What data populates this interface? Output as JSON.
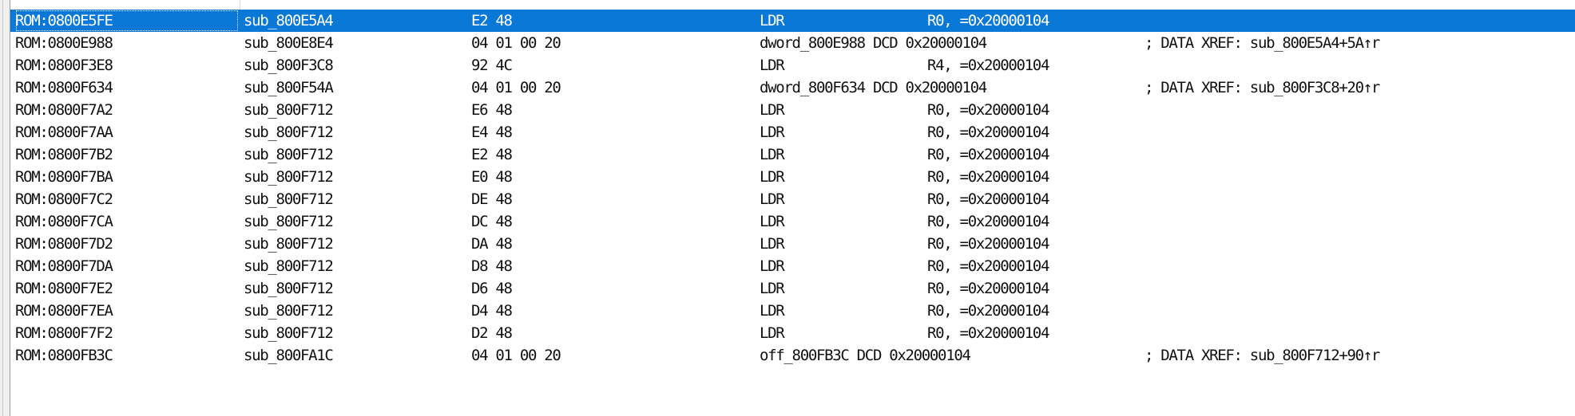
{
  "window": {
    "view": "IDA function xref listing"
  },
  "rows": [
    {
      "address": "ROM:0800E5FE",
      "function": "sub_800E5A4",
      "bytes": "E2 48",
      "mnemonic": "LDR",
      "operands": "R0, =0x20000104",
      "instruction": "",
      "comment": "",
      "selected": true
    },
    {
      "address": "ROM:0800E988",
      "function": "sub_800E8E4",
      "bytes": "04 01 00 20",
      "mnemonic": "",
      "operands": "",
      "instruction": "dword_800E988 DCD 0x20000104",
      "comment": "; DATA XREF: sub_800E5A4+5A↑r",
      "selected": false
    },
    {
      "address": "ROM:0800F3E8",
      "function": "sub_800F3C8",
      "bytes": "92 4C",
      "mnemonic": "LDR",
      "operands": "R4, =0x20000104",
      "instruction": "",
      "comment": "",
      "selected": false
    },
    {
      "address": "ROM:0800F634",
      "function": "sub_800F54A",
      "bytes": "04 01 00 20",
      "mnemonic": "",
      "operands": "",
      "instruction": "dword_800F634 DCD 0x20000104",
      "comment": "; DATA XREF: sub_800F3C8+20↑r",
      "selected": false
    },
    {
      "address": "ROM:0800F7A2",
      "function": "sub_800F712",
      "bytes": "E6 48",
      "mnemonic": "LDR",
      "operands": "R0, =0x20000104",
      "instruction": "",
      "comment": "",
      "selected": false
    },
    {
      "address": "ROM:0800F7AA",
      "function": "sub_800F712",
      "bytes": "E4 48",
      "mnemonic": "LDR",
      "operands": "R0, =0x20000104",
      "instruction": "",
      "comment": "",
      "selected": false
    },
    {
      "address": "ROM:0800F7B2",
      "function": "sub_800F712",
      "bytes": "E2 48",
      "mnemonic": "LDR",
      "operands": "R0, =0x20000104",
      "instruction": "",
      "comment": "",
      "selected": false
    },
    {
      "address": "ROM:0800F7BA",
      "function": "sub_800F712",
      "bytes": "E0 48",
      "mnemonic": "LDR",
      "operands": "R0, =0x20000104",
      "instruction": "",
      "comment": "",
      "selected": false
    },
    {
      "address": "ROM:0800F7C2",
      "function": "sub_800F712",
      "bytes": "DE 48",
      "mnemonic": "LDR",
      "operands": "R0, =0x20000104",
      "instruction": "",
      "comment": "",
      "selected": false
    },
    {
      "address": "ROM:0800F7CA",
      "function": "sub_800F712",
      "bytes": "DC 48",
      "mnemonic": "LDR",
      "operands": "R0, =0x20000104",
      "instruction": "",
      "comment": "",
      "selected": false
    },
    {
      "address": "ROM:0800F7D2",
      "function": "sub_800F712",
      "bytes": "DA 48",
      "mnemonic": "LDR",
      "operands": "R0, =0x20000104",
      "instruction": "",
      "comment": "",
      "selected": false
    },
    {
      "address": "ROM:0800F7DA",
      "function": "sub_800F712",
      "bytes": "D8 48",
      "mnemonic": "LDR",
      "operands": "R0, =0x20000104",
      "instruction": "",
      "comment": "",
      "selected": false
    },
    {
      "address": "ROM:0800F7E2",
      "function": "sub_800F712",
      "bytes": "D6 48",
      "mnemonic": "LDR",
      "operands": "R0, =0x20000104",
      "instruction": "",
      "comment": "",
      "selected": false
    },
    {
      "address": "ROM:0800F7EA",
      "function": "sub_800F712",
      "bytes": "D4 48",
      "mnemonic": "LDR",
      "operands": "R0, =0x20000104",
      "instruction": "",
      "comment": "",
      "selected": false
    },
    {
      "address": "ROM:0800F7F2",
      "function": "sub_800F712",
      "bytes": "D2 48",
      "mnemonic": "LDR",
      "operands": "R0, =0x20000104",
      "instruction": "",
      "comment": "",
      "selected": false
    },
    {
      "address": "ROM:0800FB3C",
      "function": "sub_800FA1C",
      "bytes": "04 01 00 20",
      "mnemonic": "",
      "operands": "",
      "instruction": "off_800FB3C DCD 0x20000104",
      "comment": "; DATA XREF: sub_800F712+90↑r",
      "selected": false
    }
  ],
  "colors": {
    "selection": "#0a78d7",
    "text": "#111111",
    "background": "#ffffff"
  }
}
